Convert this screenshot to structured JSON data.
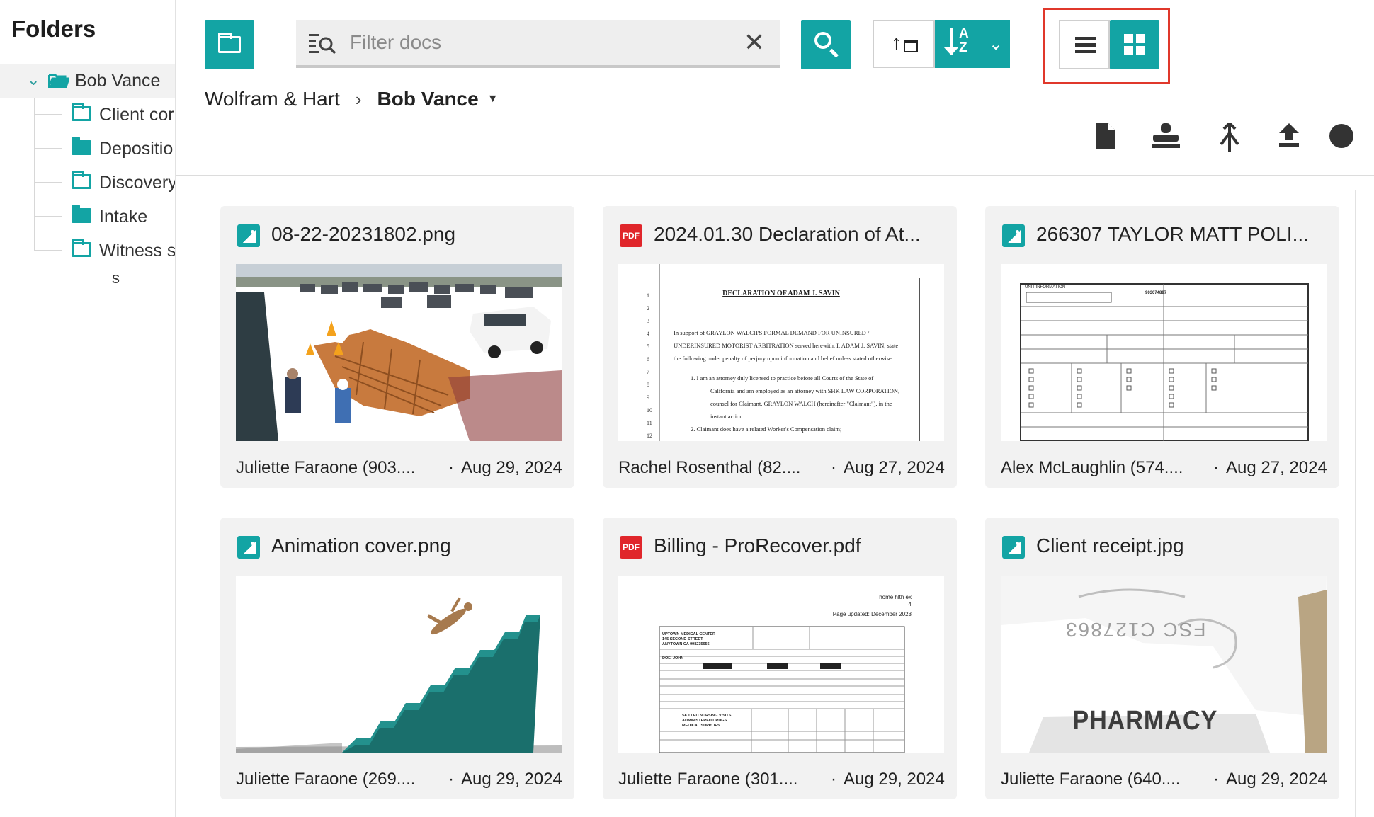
{
  "sidebar": {
    "title": "Folders",
    "root": {
      "label": "Bob Vance"
    },
    "items": [
      {
        "label": "Client cor",
        "icon": "folder-outline-icon"
      },
      {
        "label": "Depositio",
        "icon": "folder-filled-icon"
      },
      {
        "label": "Discovery",
        "icon": "folder-outline-icon"
      },
      {
        "label": "Intake",
        "icon": "folder-filled-icon"
      },
      {
        "label": "Witness s",
        "icon": "folder-outline-icon"
      }
    ],
    "wrap_text": "s"
  },
  "toolbar": {
    "search_placeholder": "Filter docs",
    "clear_label": "✕"
  },
  "breadcrumb": {
    "root": "Wolfram & Hart",
    "current": "Bob Vance"
  },
  "documents": [
    {
      "title": "08-22-20231802.png",
      "type": "image",
      "author": "Juliette Faraone (903....",
      "date": "Aug 29, 2024"
    },
    {
      "title": "2024.01.30 Declaration of At...",
      "type": "pdf",
      "author": "Rachel Rosenthal (82....",
      "date": "Aug 27, 2024"
    },
    {
      "title": "266307 TAYLOR MATT POLI...",
      "type": "image",
      "author": "Alex McLaughlin (574....",
      "date": "Aug 27, 2024"
    },
    {
      "title": "Animation cover.png",
      "type": "image",
      "author": "Juliette Faraone (269....",
      "date": "Aug 29, 2024"
    },
    {
      "title": "Billing - ProRecover.pdf",
      "type": "pdf",
      "author": "Juliette Faraone (301....",
      "date": "Aug 29, 2024"
    },
    {
      "title": "Client receipt.jpg",
      "type": "image",
      "author": "Juliette Faraone (640....",
      "date": "Aug 29, 2024"
    }
  ],
  "thumbnails": {
    "declaration_heading": "DECLARATION OF ADAM J. SAVIN",
    "declaration_lines": [
      "In support of GRAYLON WALCH'S FORMAL DEMAND FOR UNINSURED /",
      "UNDERINSURED MOTORIST ARBITRATION served herewith, I, ADAM J. SAVIN, state",
      "the following under penalty of perjury upon information and belief unless stated otherwise:",
      "1.   I am an attorney duly licensed to practice before all Courts of the State of",
      "California and am employed as an attorney with SHK LAW CORPORATION,",
      "counsel for Claimant, GRAYLON WALCH (hereinafter \"Claimant\"), in the",
      "instant action.",
      "2.   Claimant does have a related Worker's Compensation claim;"
    ],
    "police_header": "UNIT INFORMATION",
    "police_number": "903074897",
    "billing_top": "home hlth ex",
    "billing_page": "4",
    "billing_updated": "Page updated: December 2023",
    "billing_center": "UPTOWN MEDICAL CENTER",
    "billing_street": "145 SECOND STREET",
    "billing_city": "ANYTOWN CA 998235656",
    "billing_patient": "DOE, JOHN",
    "billing_rows": [
      "SKILLED NURSING VISITS",
      "ADMINISTERED DRUGS",
      "MEDICAL SUPPLIES"
    ],
    "receipt_text": "PHARMACY",
    "receipt_code": "FSC C127863"
  },
  "colors": {
    "accent": "#13a4a4",
    "highlight": "#e0382b",
    "pdf": "#e0262b"
  }
}
